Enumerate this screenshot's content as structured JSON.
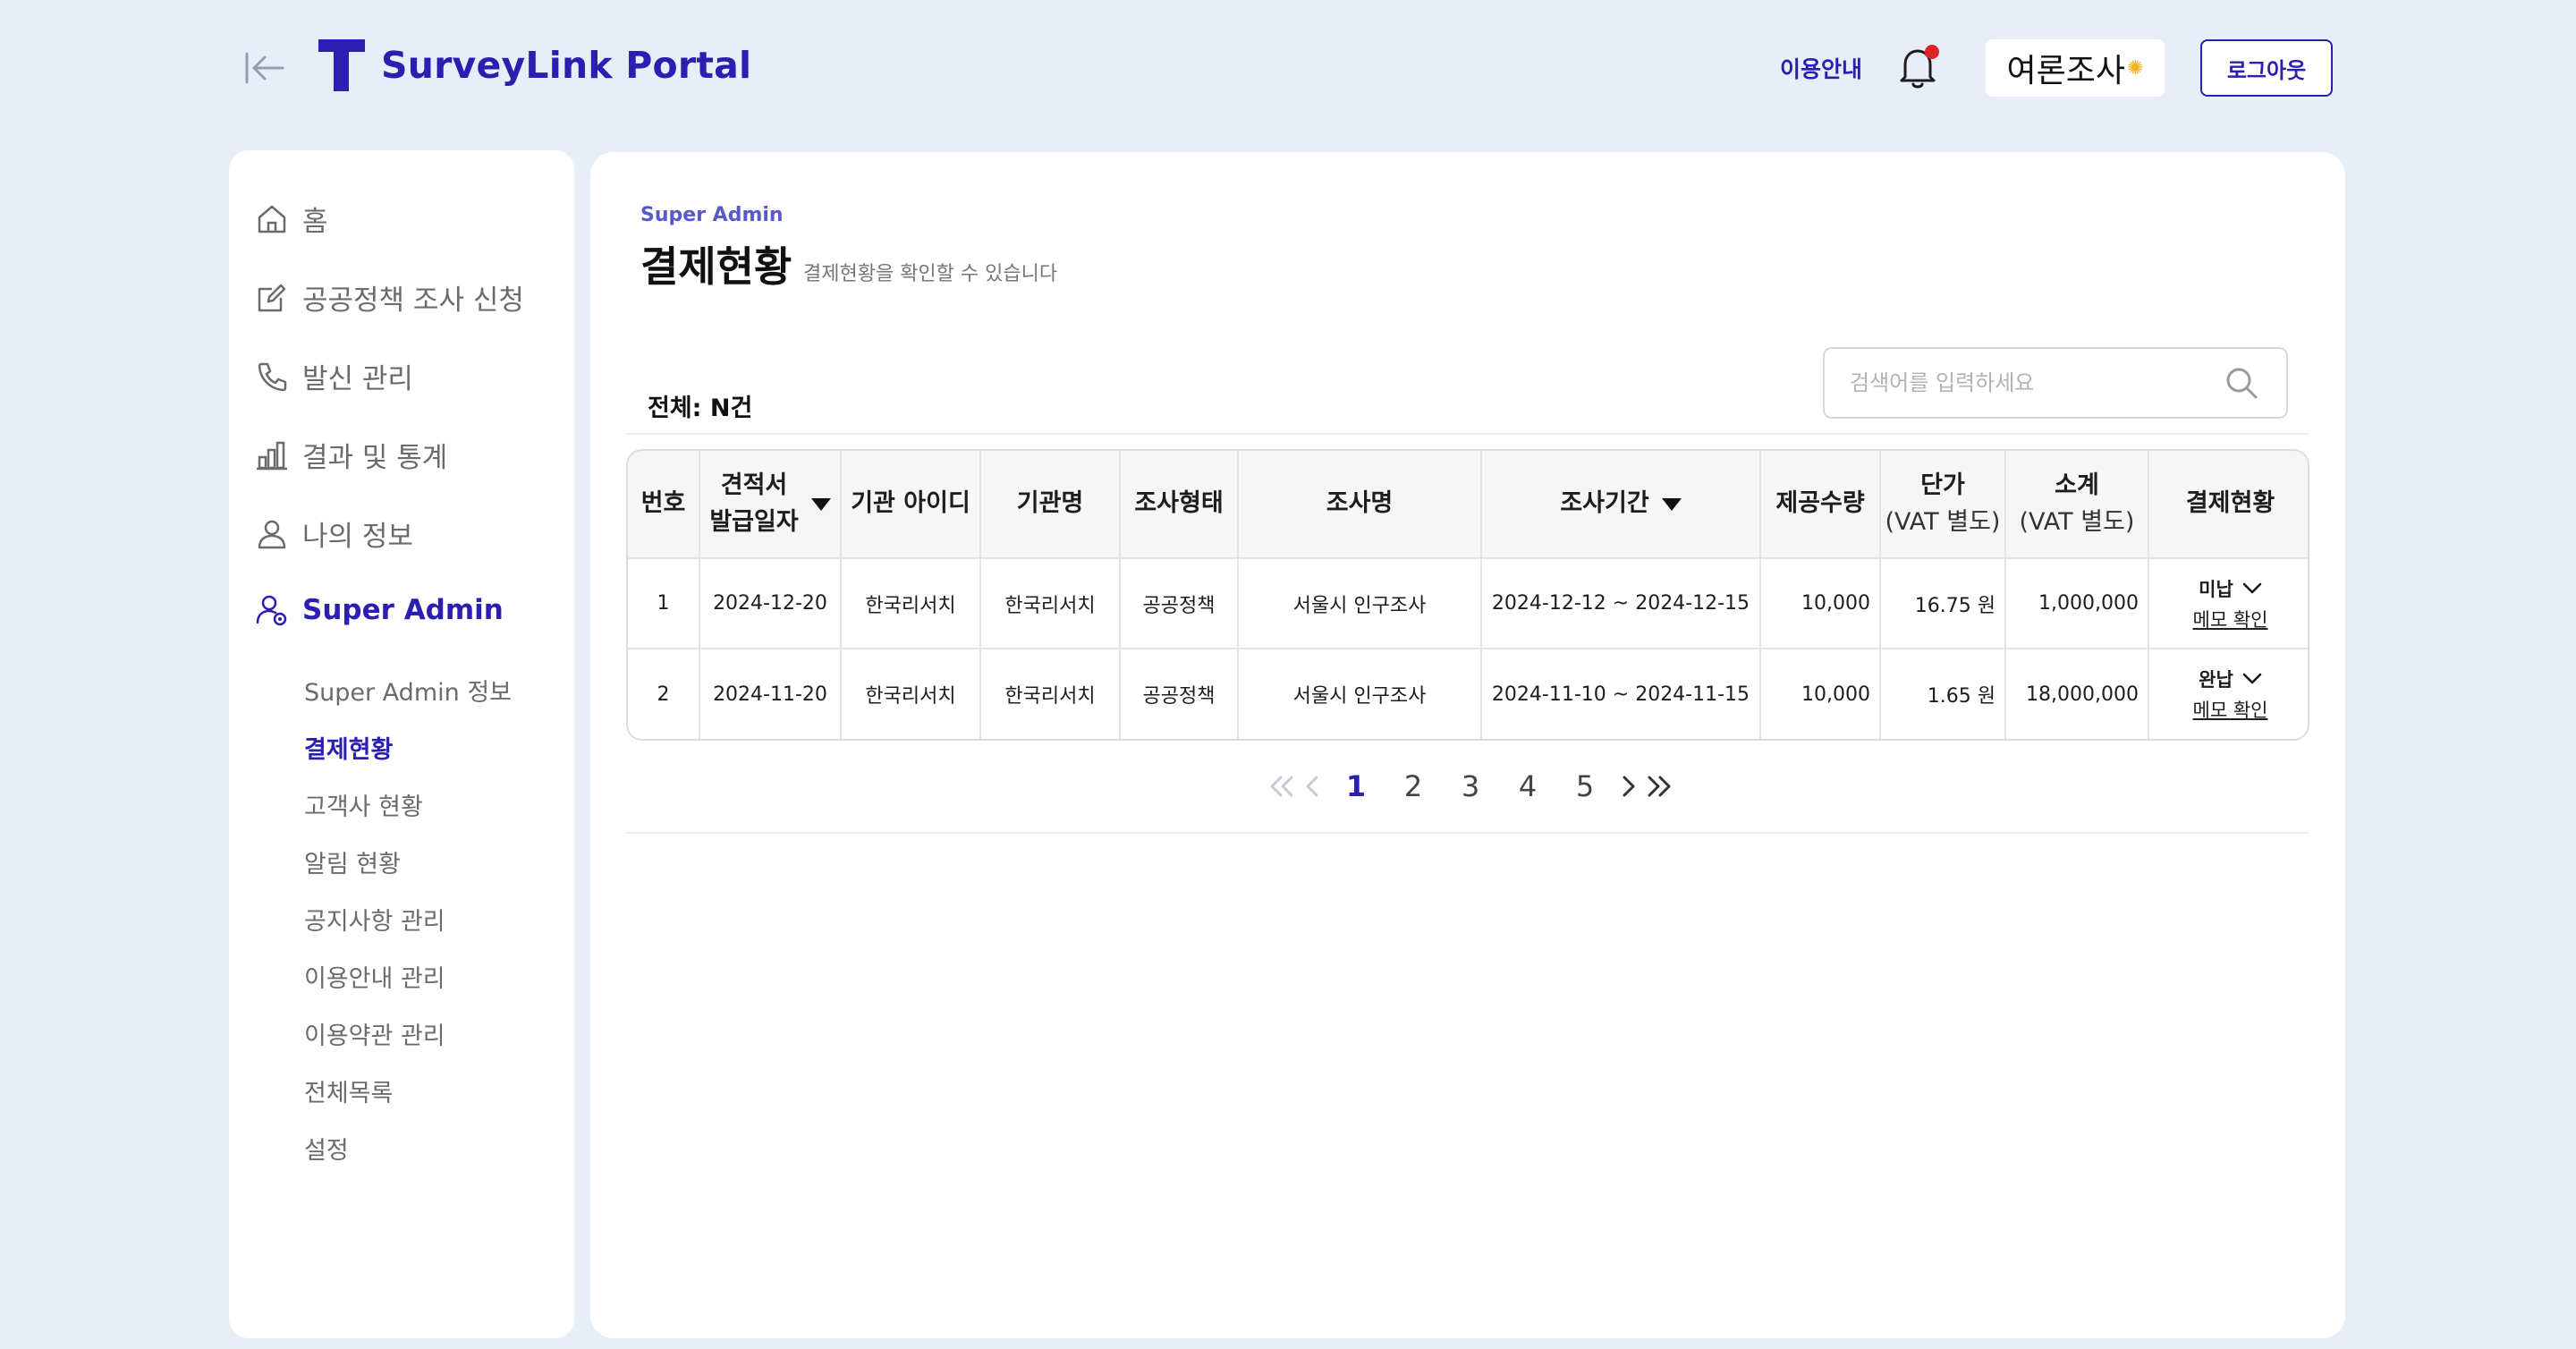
{
  "header": {
    "app_title": "SurveyLink Portal",
    "guide_link": "이용안내",
    "partner_badge": "여론조사",
    "logout_label": "로그아웃"
  },
  "sidebar": {
    "items": [
      {
        "label": "홈",
        "icon": "home-icon"
      },
      {
        "label": "공공정책 조사 신청",
        "icon": "edit-icon"
      },
      {
        "label": "발신 관리",
        "icon": "phone-icon"
      },
      {
        "label": "결과 및 통계",
        "icon": "bar-chart-icon"
      },
      {
        "label": "나의 정보",
        "icon": "user-icon"
      },
      {
        "label": "Super Admin",
        "icon": "admin-user-icon"
      }
    ],
    "sub_items": [
      "Super Admin 정보",
      "결제현황",
      "고객사 현황",
      "알림 현황",
      "공지사항 관리",
      "이용안내 관리",
      "이용약관 관리",
      "전체목록",
      "설정"
    ],
    "active_sub_item": "결제현황"
  },
  "main": {
    "breadcrumb": "Super Admin",
    "title": "결제현황",
    "subtitle": "결제현황을 확인할 수 있습니다",
    "total_label": "전체: N건",
    "search_placeholder": "검색어를 입력하세요"
  },
  "table": {
    "headers": {
      "no": "번호",
      "issue_date_1": "견적서",
      "issue_date_2": "발급일자",
      "org_id": "기관 아이디",
      "org_name": "기관명",
      "survey_type": "조사형태",
      "survey_name": "조사명",
      "survey_period": "조사기간",
      "quantity": "제공수량",
      "unit_price_1": "단가",
      "unit_price_2": "(VAT 별도)",
      "subtotal_1": "소계",
      "subtotal_2": "(VAT 별도)",
      "payment_status": "결제현황"
    },
    "rows": [
      {
        "no": "1",
        "issue_date": "2024-12-20",
        "org_id": "한국리서치",
        "org_name": "한국리서치",
        "survey_type": "공공정책",
        "survey_name": "서울시 인구조사",
        "survey_period": "2024-12-12 ~ 2024-12-15",
        "quantity": "10,000",
        "unit_price": "16.75 원",
        "subtotal": "1,000,000",
        "status": "미납",
        "memo": "메모 확인"
      },
      {
        "no": "2",
        "issue_date": "2024-11-20",
        "org_id": "한국리서치",
        "org_name": "한국리서치",
        "survey_type": "공공정책",
        "survey_name": "서울시 인구조사",
        "survey_period": "2024-11-10 ~ 2024-11-15",
        "quantity": "10,000",
        "unit_price": "1.65 원",
        "subtotal": "18,000,000",
        "status": "완납",
        "memo": "메모 확인"
      }
    ]
  },
  "pagination": {
    "pages": [
      "1",
      "2",
      "3",
      "4",
      "5"
    ],
    "current": "1"
  },
  "colors": {
    "accent": "#2a1fb0",
    "background": "#e8eef7",
    "notification_dot": "#e0222a"
  }
}
